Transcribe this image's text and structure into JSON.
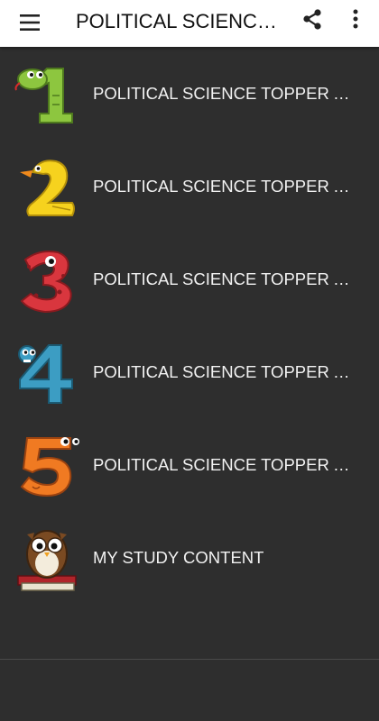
{
  "appbar": {
    "title": "POLITICAL SCIENCE TOPPER ANSWER SHEET",
    "menu_icon": "hamburger-menu-icon",
    "share_icon": "share-icon",
    "more_icon": "more-vertical-icon"
  },
  "items": [
    {
      "label": "POLITICAL SCIENCE  TOPPER ANSWER SHEET",
      "icon": "number-1-snake-icon"
    },
    {
      "label": "POLITICAL SCIENCE  TOPPER ANSWER SHEET",
      "icon": "number-2-duck-icon"
    },
    {
      "label": "POLITICAL SCIENCE  TOPPER ANSWER SHEET",
      "icon": "number-3-monster-icon"
    },
    {
      "label": "POLITICAL SCIENCE  TOPPER ANSWER SHEET",
      "icon": "number-4-monster-icon"
    },
    {
      "label": "POLITICAL SCIENCE  TOPPER ANSWER SHEET",
      "icon": "number-5-monster-icon"
    },
    {
      "label": "MY STUDY CONTENT",
      "icon": "owl-on-books-icon"
    }
  ],
  "colors": {
    "appbar_bg": "#ffffff",
    "list_bg": "#2e2e2e",
    "text_light": "#f2f2f2"
  }
}
